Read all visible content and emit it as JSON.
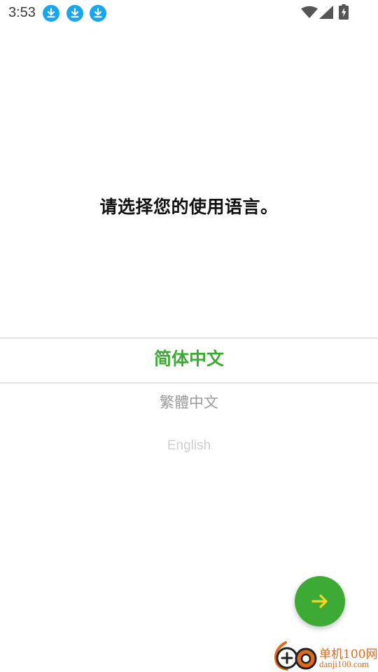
{
  "status_bar": {
    "time": "3:53",
    "notification_icons": [
      "download-icon",
      "download-icon",
      "download-icon"
    ],
    "notification_icon_color": "#17a7f0",
    "system_icons": [
      "wifi-icon",
      "cellular-signal-icon",
      "battery-charging-icon"
    ]
  },
  "main": {
    "title": "请选择您的使用语言。"
  },
  "language_picker": {
    "options": [
      {
        "label": "简体中文",
        "selected": true
      },
      {
        "label": "繁體中文",
        "selected": false
      },
      {
        "label": "English",
        "selected": false
      }
    ]
  },
  "fab": {
    "icon": "arrow-right-icon"
  },
  "watermark": {
    "main_text": "单机100网",
    "url_text": "danji100.com"
  },
  "colors": {
    "accent_green": "#3daa35",
    "arrow_yellow": "#f5d51d",
    "text_primary": "#111111",
    "text_secondary": "#9a9a9a",
    "text_tertiary": "#cfcfcf",
    "divider": "#e4e4e4",
    "watermark_orange": "#e06a1b"
  }
}
